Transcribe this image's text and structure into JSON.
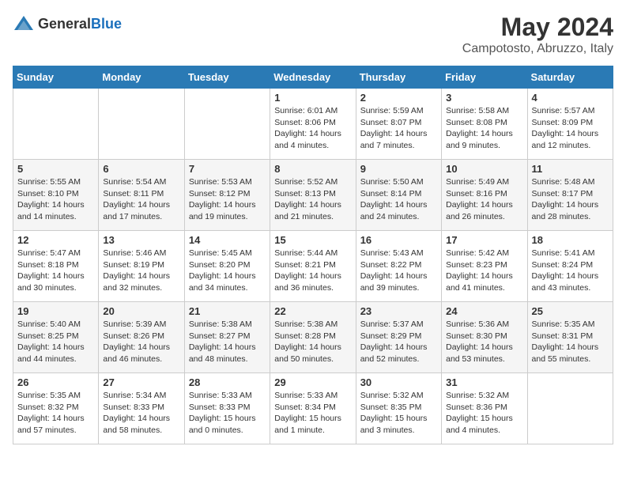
{
  "logo": {
    "general": "General",
    "blue": "Blue"
  },
  "title": "May 2024",
  "subtitle": "Campotosto, Abruzzo, Italy",
  "weekdays": [
    "Sunday",
    "Monday",
    "Tuesday",
    "Wednesday",
    "Thursday",
    "Friday",
    "Saturday"
  ],
  "weeks": [
    [
      {
        "day": "",
        "info": ""
      },
      {
        "day": "",
        "info": ""
      },
      {
        "day": "",
        "info": ""
      },
      {
        "day": "1",
        "info": "Sunrise: 6:01 AM\nSunset: 8:06 PM\nDaylight: 14 hours\nand 4 minutes."
      },
      {
        "day": "2",
        "info": "Sunrise: 5:59 AM\nSunset: 8:07 PM\nDaylight: 14 hours\nand 7 minutes."
      },
      {
        "day": "3",
        "info": "Sunrise: 5:58 AM\nSunset: 8:08 PM\nDaylight: 14 hours\nand 9 minutes."
      },
      {
        "day": "4",
        "info": "Sunrise: 5:57 AM\nSunset: 8:09 PM\nDaylight: 14 hours\nand 12 minutes."
      }
    ],
    [
      {
        "day": "5",
        "info": "Sunrise: 5:55 AM\nSunset: 8:10 PM\nDaylight: 14 hours\nand 14 minutes."
      },
      {
        "day": "6",
        "info": "Sunrise: 5:54 AM\nSunset: 8:11 PM\nDaylight: 14 hours\nand 17 minutes."
      },
      {
        "day": "7",
        "info": "Sunrise: 5:53 AM\nSunset: 8:12 PM\nDaylight: 14 hours\nand 19 minutes."
      },
      {
        "day": "8",
        "info": "Sunrise: 5:52 AM\nSunset: 8:13 PM\nDaylight: 14 hours\nand 21 minutes."
      },
      {
        "day": "9",
        "info": "Sunrise: 5:50 AM\nSunset: 8:14 PM\nDaylight: 14 hours\nand 24 minutes."
      },
      {
        "day": "10",
        "info": "Sunrise: 5:49 AM\nSunset: 8:16 PM\nDaylight: 14 hours\nand 26 minutes."
      },
      {
        "day": "11",
        "info": "Sunrise: 5:48 AM\nSunset: 8:17 PM\nDaylight: 14 hours\nand 28 minutes."
      }
    ],
    [
      {
        "day": "12",
        "info": "Sunrise: 5:47 AM\nSunset: 8:18 PM\nDaylight: 14 hours\nand 30 minutes."
      },
      {
        "day": "13",
        "info": "Sunrise: 5:46 AM\nSunset: 8:19 PM\nDaylight: 14 hours\nand 32 minutes."
      },
      {
        "day": "14",
        "info": "Sunrise: 5:45 AM\nSunset: 8:20 PM\nDaylight: 14 hours\nand 34 minutes."
      },
      {
        "day": "15",
        "info": "Sunrise: 5:44 AM\nSunset: 8:21 PM\nDaylight: 14 hours\nand 36 minutes."
      },
      {
        "day": "16",
        "info": "Sunrise: 5:43 AM\nSunset: 8:22 PM\nDaylight: 14 hours\nand 39 minutes."
      },
      {
        "day": "17",
        "info": "Sunrise: 5:42 AM\nSunset: 8:23 PM\nDaylight: 14 hours\nand 41 minutes."
      },
      {
        "day": "18",
        "info": "Sunrise: 5:41 AM\nSunset: 8:24 PM\nDaylight: 14 hours\nand 43 minutes."
      }
    ],
    [
      {
        "day": "19",
        "info": "Sunrise: 5:40 AM\nSunset: 8:25 PM\nDaylight: 14 hours\nand 44 minutes."
      },
      {
        "day": "20",
        "info": "Sunrise: 5:39 AM\nSunset: 8:26 PM\nDaylight: 14 hours\nand 46 minutes."
      },
      {
        "day": "21",
        "info": "Sunrise: 5:38 AM\nSunset: 8:27 PM\nDaylight: 14 hours\nand 48 minutes."
      },
      {
        "day": "22",
        "info": "Sunrise: 5:38 AM\nSunset: 8:28 PM\nDaylight: 14 hours\nand 50 minutes."
      },
      {
        "day": "23",
        "info": "Sunrise: 5:37 AM\nSunset: 8:29 PM\nDaylight: 14 hours\nand 52 minutes."
      },
      {
        "day": "24",
        "info": "Sunrise: 5:36 AM\nSunset: 8:30 PM\nDaylight: 14 hours\nand 53 minutes."
      },
      {
        "day": "25",
        "info": "Sunrise: 5:35 AM\nSunset: 8:31 PM\nDaylight: 14 hours\nand 55 minutes."
      }
    ],
    [
      {
        "day": "26",
        "info": "Sunrise: 5:35 AM\nSunset: 8:32 PM\nDaylight: 14 hours\nand 57 minutes."
      },
      {
        "day": "27",
        "info": "Sunrise: 5:34 AM\nSunset: 8:33 PM\nDaylight: 14 hours\nand 58 minutes."
      },
      {
        "day": "28",
        "info": "Sunrise: 5:33 AM\nSunset: 8:33 PM\nDaylight: 15 hours\nand 0 minutes."
      },
      {
        "day": "29",
        "info": "Sunrise: 5:33 AM\nSunset: 8:34 PM\nDaylight: 15 hours\nand 1 minute."
      },
      {
        "day": "30",
        "info": "Sunrise: 5:32 AM\nSunset: 8:35 PM\nDaylight: 15 hours\nand 3 minutes."
      },
      {
        "day": "31",
        "info": "Sunrise: 5:32 AM\nSunset: 8:36 PM\nDaylight: 15 hours\nand 4 minutes."
      },
      {
        "day": "",
        "info": ""
      }
    ]
  ]
}
